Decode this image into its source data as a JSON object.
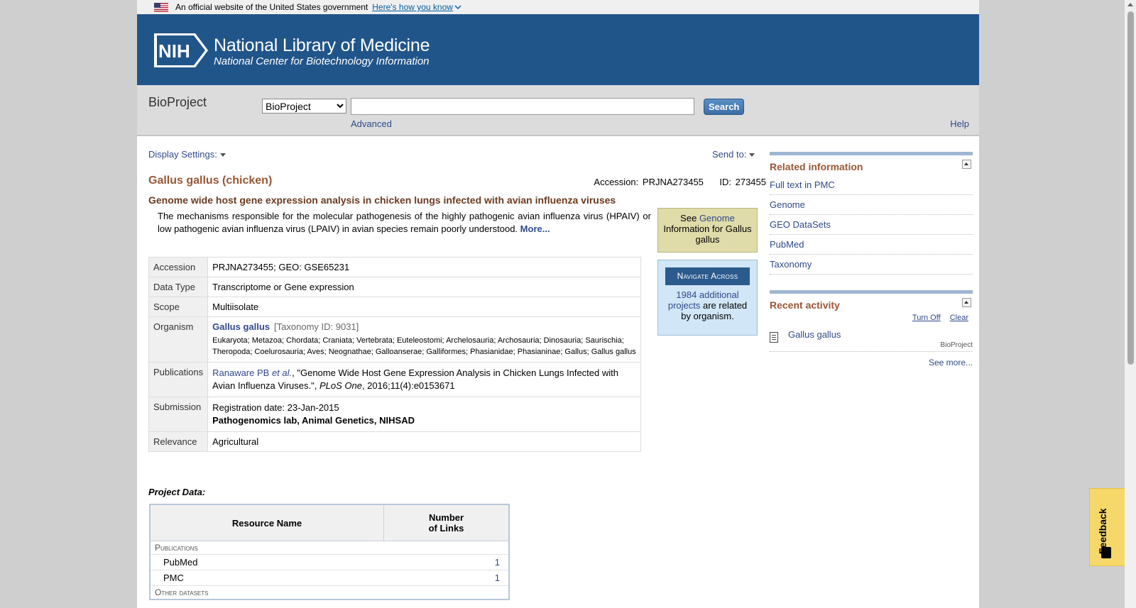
{
  "gov_banner": {
    "text": "An official website of the United States government",
    "how_link": "Here's how you know"
  },
  "header": {
    "logo_text": "NIH",
    "title": "National Library of Medicine",
    "subtitle": "National Center for Biotechnology Information"
  },
  "search": {
    "db_title": "BioProject",
    "db_options": [
      "BioProject"
    ],
    "db_selected": "BioProject",
    "query": "",
    "button": "Search",
    "advanced": "Advanced",
    "help": "Help"
  },
  "toolbar": {
    "display_settings": "Display Settings:",
    "send_to": "Send to:"
  },
  "record": {
    "title": "Gallus gallus (chicken)",
    "accession_label": "Accession:",
    "accession": "PRJNA273455",
    "id_label": "ID:",
    "id": "273455",
    "subtitle": "Genome wide host gene expression analysis in chicken lungs infected with avian influenza viruses",
    "description": "The mechanisms responsible for the molecular pathogenesis of the highly pathogenic avian influenza virus (HPAIV) or low pathogenic avian influenza virus (LPAIV) in avian species remain poorly understood.",
    "more": "More..."
  },
  "see_box": {
    "see": "See",
    "genome_link": "Genome",
    "text": "Information for Gallus gallus"
  },
  "navigate": {
    "header": "Navigate Across",
    "count_link": "1984 additional projects",
    "text": "are related by organism."
  },
  "details": {
    "accession": {
      "label": "Accession",
      "value": "PRJNA273455; GEO: GSE65231"
    },
    "data_type": {
      "label": "Data Type",
      "value": "Transcriptome or Gene expression"
    },
    "scope": {
      "label": "Scope",
      "value": "Multiisolate"
    },
    "organism": {
      "label": "Organism",
      "name": "Gallus gallus",
      "taxid": "[Taxonomy ID: 9031]",
      "lineage": "Eukaryota; Metazoa; Chordata; Craniata; Vertebrata; Euteleostomi; Archelosauria; Archosauria; Dinosauria; Saurischia; Theropoda; Coelurosauria; Aves; Neognathae; Galloanserae; Galliformes; Phasianidae; Phasianinae; Gallus; Gallus gallus"
    },
    "publications": {
      "label": "Publications",
      "authors": "Ranaware PB",
      "etal": "et al.",
      "title_text": ", \"Genome Wide Host Gene Expression Analysis in Chicken Lungs Infected with Avian Influenza Viruses.\", ",
      "journal": "PLoS One",
      "citation": ", 2016;11(4):e0153671"
    },
    "submission": {
      "label": "Submission",
      "date": "Registration date: 23-Jan-2015",
      "org": "Pathogenomics lab, Animal Genetics, NIHSAD"
    },
    "relevance": {
      "label": "Relevance",
      "value": "Agricultural"
    }
  },
  "project_data": {
    "label": "Project Data:",
    "col_resource": "Resource Name",
    "col_links_1": "Number",
    "col_links_2": "of Links",
    "groups": [
      {
        "name": "Publications",
        "rows": [
          {
            "name": "PubMed",
            "count": "1"
          },
          {
            "name": "PMC",
            "count": "1"
          }
        ]
      },
      {
        "name": "Other datasets",
        "rows": []
      }
    ]
  },
  "related": {
    "title": "Related information",
    "items": [
      "Full text in PMC",
      "Genome",
      "GEO DataSets",
      "PubMed",
      "Taxonomy"
    ]
  },
  "recent": {
    "title": "Recent activity",
    "turn_off": "Turn Off",
    "clear": "Clear",
    "items": [
      {
        "name": "Gallus gallus",
        "db": "BioProject"
      }
    ],
    "see_more": "See more..."
  },
  "feedback": {
    "label": "Feedback"
  }
}
